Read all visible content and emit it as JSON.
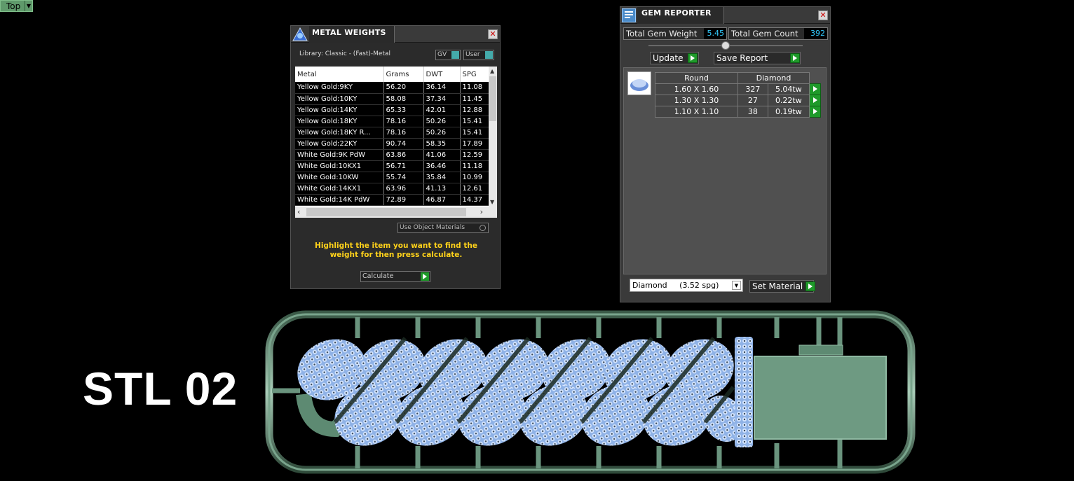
{
  "viewport": {
    "label": "Top"
  },
  "metal_weights": {
    "title": "METAL WEIGHTS",
    "library": "Library: Classic - (Fast)-Metal",
    "toggle_gv": "GV",
    "toggle_user": "User",
    "columns": [
      "Metal",
      "Grams",
      "DWT",
      "SPG"
    ],
    "rows": [
      [
        "Yellow Gold:9KY",
        "56.20",
        "36.14",
        "11.08"
      ],
      [
        "Yellow Gold:10KY",
        "58.08",
        "37.34",
        "11.45"
      ],
      [
        "Yellow Gold:14KY",
        "65.33",
        "42.01",
        "12.88"
      ],
      [
        "Yellow Gold:18KY",
        "78.16",
        "50.26",
        "15.41"
      ],
      [
        "Yellow Gold:18KY R...",
        "78.16",
        "50.26",
        "15.41"
      ],
      [
        "Yellow Gold:22KY",
        "90.74",
        "58.35",
        "17.89"
      ],
      [
        "White Gold:9K PdW",
        "63.86",
        "41.06",
        "12.59"
      ],
      [
        "White Gold:10KX1",
        "56.71",
        "36.46",
        "11.18"
      ],
      [
        "White Gold:10KW",
        "55.74",
        "35.84",
        "10.99"
      ],
      [
        "White Gold:14KX1",
        "63.96",
        "41.13",
        "12.61"
      ],
      [
        "White Gold:14K PdW",
        "72.89",
        "46.87",
        "14.37"
      ]
    ],
    "use_object_materials": "Use Object Materials",
    "instruction": "Highlight the item you want to find the weight for then press calculate.",
    "calculate": "Calculate"
  },
  "gem_reporter": {
    "title": "GEM REPORTER",
    "total_weight_label": "Total Gem Weight",
    "total_weight_value": "5.45",
    "total_count_label": "Total Gem Count",
    "total_count_value": "392",
    "update": "Update",
    "save_report": "Save Report",
    "col_shape": "Round",
    "col_material": "Diamond",
    "rows": [
      [
        "1.60 X 1.60",
        "327",
        "5.04tw"
      ],
      [
        "1.30 X 1.30",
        "27",
        "0.22tw"
      ],
      [
        "1.10 X 1.10",
        "38",
        "0.19tw"
      ]
    ],
    "material_select": "Diamond     (3.52 spg)",
    "set_material": "Set Material"
  },
  "model_label": "STL 02",
  "colors": {
    "metal": "#6e9a82",
    "diamond": "#b8d0f0",
    "instruction": "#ffd21a",
    "gem_value": "#33ccff"
  }
}
